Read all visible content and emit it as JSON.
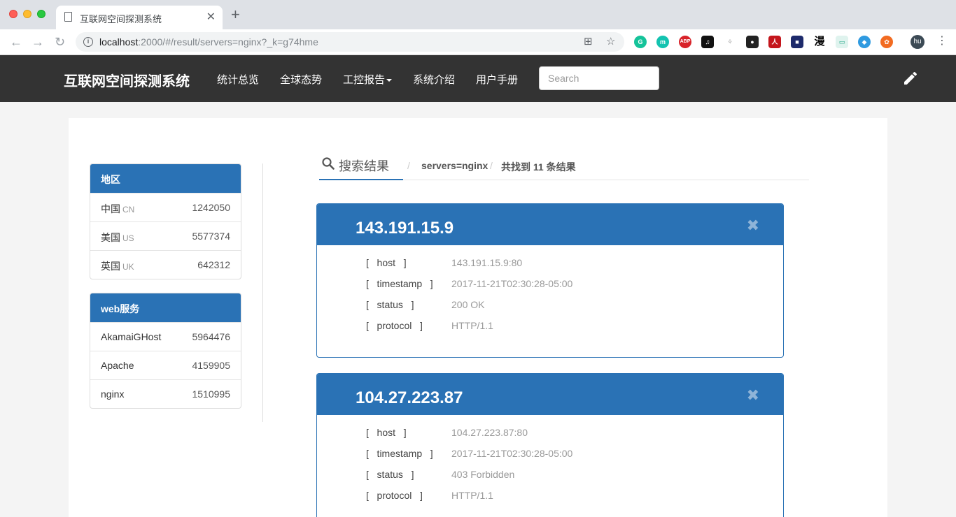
{
  "browser": {
    "tab_title": "互联网空间探测系统",
    "tab_close": "✕",
    "new_tab": "+",
    "url_host": "localhost",
    "url_rest": ":2000/#/result/servers=nginx?_k=g74hme",
    "profile_initials": "hu",
    "extensions": [
      "grammarly-icon",
      "m-icon",
      "abp-icon",
      "music-icon",
      "tree-icon",
      "bear-icon",
      "pdf-icon",
      "cube-icon",
      "漫",
      "screen-icon",
      "shield-icon",
      "orange-icon"
    ]
  },
  "navbar": {
    "brand": "互联网空间探测系统",
    "items": [
      "统计总览",
      "全球态势",
      "工控报告",
      "系统介绍",
      "用户手册"
    ],
    "search_placeholder": "Search"
  },
  "sidebar": {
    "region": {
      "title": "地区",
      "rows": [
        {
          "name": "中国",
          "code": "CN",
          "count": "1242050"
        },
        {
          "name": "美国",
          "code": "US",
          "count": "5577374"
        },
        {
          "name": "英国",
          "code": "UK",
          "count": "642312"
        }
      ]
    },
    "web": {
      "title": "web服务",
      "rows": [
        {
          "name": "AkamaiGHost",
          "count": "5964476"
        },
        {
          "name": "Apache",
          "count": "4159905"
        },
        {
          "name": "nginx",
          "count": "1510995"
        }
      ]
    }
  },
  "breadcrumb": {
    "title": "搜索结果",
    "sep": "/",
    "query": "servers=nginx",
    "summary": "共找到 11 条结果"
  },
  "results": [
    {
      "ip": "143.191.15.9",
      "close": "✖",
      "fields": [
        {
          "label": "[   host   ]",
          "value": "143.191.15.9:80"
        },
        {
          "label": "[   timestamp   ]",
          "value": "2017-11-21T02:30:28-05:00"
        },
        {
          "label": "[   status   ]",
          "value": "200 OK"
        },
        {
          "label": "[   protocol   ]",
          "value": "HTTP/1.1"
        }
      ]
    },
    {
      "ip": "104.27.223.87",
      "close": "✖",
      "fields": [
        {
          "label": "[   host   ]",
          "value": "104.27.223.87:80"
        },
        {
          "label": "[   timestamp   ]",
          "value": "2017-11-21T02:30:28-05:00"
        },
        {
          "label": "[   status   ]",
          "value": "403 Forbidden"
        },
        {
          "label": "[   protocol   ]",
          "value": "HTTP/1.1"
        }
      ]
    }
  ]
}
